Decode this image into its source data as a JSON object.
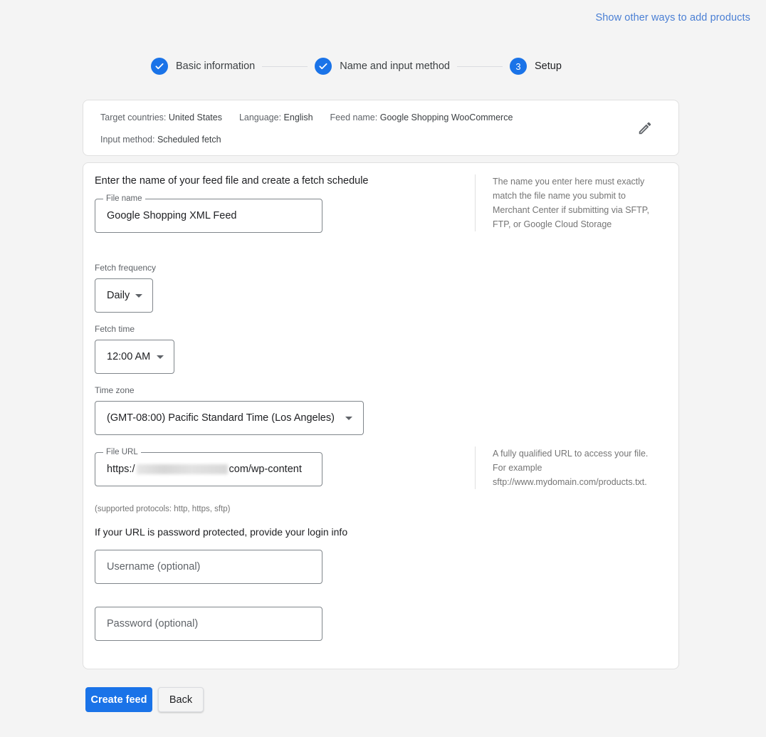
{
  "header": {
    "other_ways_link": "Show other ways to add products"
  },
  "stepper": {
    "steps": [
      {
        "label": "Basic information",
        "state": "complete",
        "icon": "check-icon"
      },
      {
        "label": "Name and input method",
        "state": "complete",
        "icon": "check-icon"
      },
      {
        "label": "Setup",
        "state": "active",
        "number": "3"
      }
    ],
    "accent_color": "#1a73e8"
  },
  "summary": {
    "target_countries_label": "Target countries:",
    "target_countries_value": "United States",
    "language_label": "Language:",
    "language_value": "English",
    "feed_name_label": "Feed name:",
    "feed_name_value": "Google Shopping WooCommerce",
    "input_method_label": "Input method:",
    "input_method_value": "Scheduled fetch",
    "edit_icon": "pencil-icon"
  },
  "form": {
    "section_title": "Enter the name of your feed file and create a fetch schedule",
    "file_name": {
      "label": "File name",
      "value": "Google Shopping XML Feed",
      "help": "The name you enter here must exactly match the file name you submit to Merchant Center if submitting via SFTP, FTP, or Google Cloud Storage"
    },
    "fetch_frequency": {
      "label": "Fetch frequency",
      "selected": "Daily"
    },
    "fetch_time": {
      "label": "Fetch time",
      "selected": "12:00 AM"
    },
    "time_zone": {
      "label": "Time zone",
      "selected": "(GMT-08:00) Pacific Standard Time (Los Angeles)"
    },
    "file_url": {
      "label": "File URL",
      "value_prefix": "https:/",
      "value_suffix": "com/wp-content",
      "help_line1": "A fully qualified URL to access your file.",
      "help_line2": "For example",
      "help_line3": "sftp://www.mydomain.com/products.txt.",
      "protocols_note": "(supported protocols: http, https, sftp)"
    },
    "login_info_title": "If your URL is password protected, provide your login info",
    "username": {
      "placeholder": "Username (optional)",
      "value": ""
    },
    "password": {
      "placeholder": "Password (optional)",
      "value": ""
    }
  },
  "actions": {
    "create_label": "Create feed",
    "back_label": "Back"
  }
}
